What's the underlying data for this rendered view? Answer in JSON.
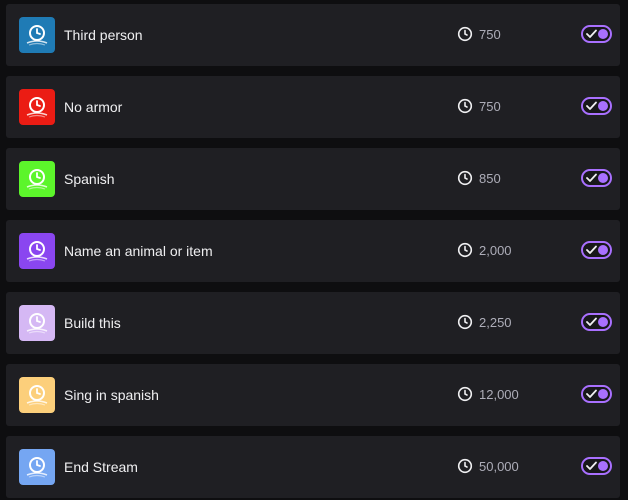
{
  "rewards": [
    {
      "title": "Third person",
      "cost": "750",
      "color": "#1f7bb5",
      "icon": "reward-icon",
      "enabled": true
    },
    {
      "title": "No armor",
      "cost": "750",
      "color": "#eb1c14",
      "icon": "reward-icon",
      "enabled": true
    },
    {
      "title": "Spanish",
      "cost": "850",
      "color": "#5cf52b",
      "icon": "reward-icon",
      "enabled": true
    },
    {
      "title": "Name an animal or item",
      "cost": "2,000",
      "color": "#8a46f0",
      "icon": "reward-icon",
      "enabled": true
    },
    {
      "title": "Build this",
      "cost": "2,250",
      "color": "#d5b8f4",
      "icon": "reward-icon",
      "enabled": true
    },
    {
      "title": "Sing in spanish",
      "cost": "12,000",
      "color": "#fccf7b",
      "icon": "reward-icon",
      "enabled": true
    },
    {
      "title": "End Stream",
      "cost": "50,000",
      "color": "#75a6f2",
      "icon": "reward-icon",
      "enabled": true
    }
  ],
  "colors": {
    "row_bg": "#1f1f23",
    "page_bg": "#0e0e10",
    "toggle_accent": "#a970ff",
    "text": "#efeff1",
    "muted_text": "#adadb8"
  },
  "icons": {
    "cost": "clock-icon",
    "toggle_state": "check-icon"
  }
}
